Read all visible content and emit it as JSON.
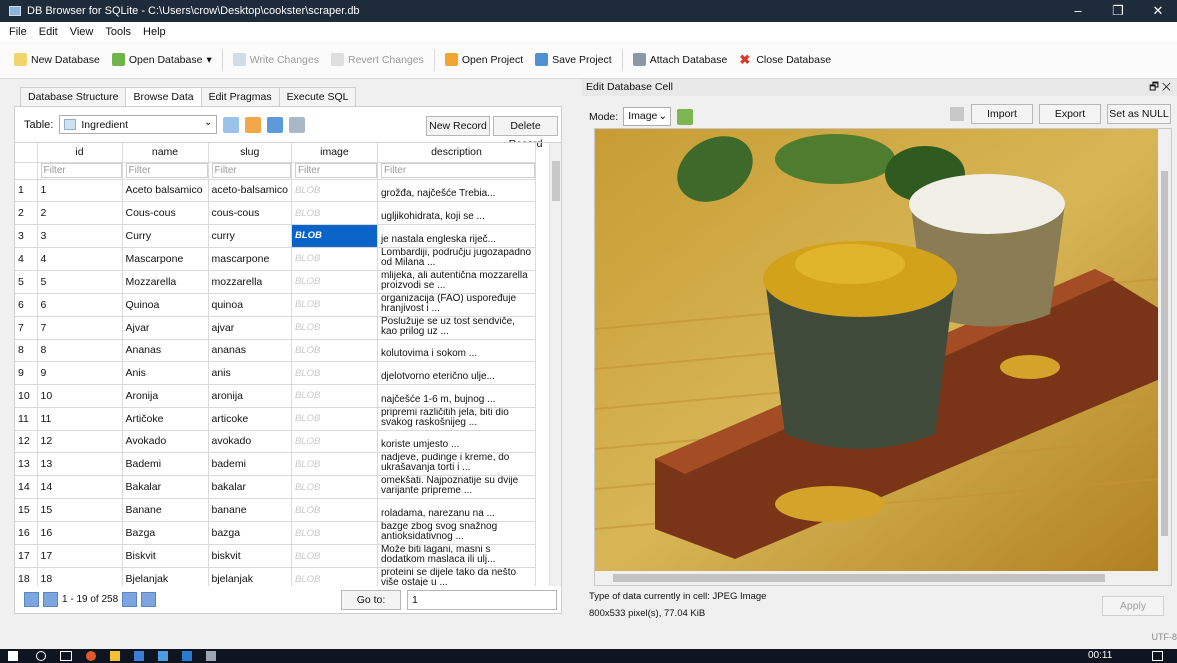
{
  "window": {
    "title": "DB Browser for SQLite - C:\\Users\\crow\\Desktop\\cookster\\scraper.db",
    "min": "–",
    "max": "❐",
    "close": "✕"
  },
  "menu": [
    "File",
    "Edit",
    "View",
    "Tools",
    "Help"
  ],
  "toolbar": {
    "new_db": "New Database",
    "open_db": "Open Database",
    "write": "Write Changes",
    "revert": "Revert Changes",
    "open_project": "Open Project",
    "save_project": "Save Project",
    "attach": "Attach Database",
    "close_db": "Close Database"
  },
  "tabs": [
    "Database Structure",
    "Browse Data",
    "Edit Pragmas",
    "Execute SQL"
  ],
  "browse": {
    "table_label": "Table:",
    "table_value": "Ingredient",
    "new_record": "New Record",
    "delete_record": "Delete Record",
    "columns": [
      "id",
      "name",
      "slug",
      "image",
      "description"
    ],
    "filter": "Filter",
    "rows": [
      [
        "1",
        "1",
        "Aceto balsamico",
        "aceto-balsamico",
        "BLOB",
        "grožđa, najčešće Trebia..."
      ],
      [
        "2",
        "2",
        "Cous-cous",
        "cous-cous",
        "BLOB",
        "ugljikohidrata, koji se ..."
      ],
      [
        "3",
        "3",
        "Curry",
        "curry",
        "BLOB",
        "je nastala engleska riječ..."
      ],
      [
        "4",
        "4",
        "Mascarpone",
        "mascarpone",
        "BLOB",
        "Lombardiji, području jugozapadno od Milana ..."
      ],
      [
        "5",
        "5",
        "Mozzarella",
        "mozzarella",
        "BLOB",
        "mlijeka, ali autentična mozzarella proizvodi se ..."
      ],
      [
        "6",
        "6",
        "Quinoa",
        "quinoa",
        "BLOB",
        "organizacija (FAO) uspoređuje hranjivost i ..."
      ],
      [
        "7",
        "7",
        "Ajvar",
        "ajvar",
        "BLOB",
        "Poslužuje se uz tost sendviče, kao prilog uz ..."
      ],
      [
        "8",
        "8",
        "Ananas",
        "ananas",
        "BLOB",
        "kolutovima i sokom ..."
      ],
      [
        "9",
        "9",
        "Anis",
        "anis",
        "BLOB",
        "djelotvorno eterično ulje..."
      ],
      [
        "10",
        "10",
        "Aronija",
        "aronija",
        "BLOB",
        "najčešće 1-6 m, bujnog ..."
      ],
      [
        "11",
        "11",
        "Artičoke",
        "articoke",
        "BLOB",
        "pripremi različitih jela, biti dio svakog raskošnijeg ..."
      ],
      [
        "12",
        "12",
        "Avokado",
        "avokado",
        "BLOB",
        "koriste umjesto ..."
      ],
      [
        "13",
        "13",
        "Bademi",
        "bademi",
        "BLOB",
        "nadjeve, pudinge i kreme, do ukrašavanja torti i ..."
      ],
      [
        "14",
        "14",
        "Bakalar",
        "bakalar",
        "BLOB",
        "omekšati. Najpoznatije su dvije varijante pripreme ..."
      ],
      [
        "15",
        "15",
        "Banane",
        "banane",
        "BLOB",
        "roladama, narezanu na ..."
      ],
      [
        "16",
        "16",
        "Bazga",
        "bazga",
        "BLOB",
        "bazge zbog svog snažnog antioksidativnog ..."
      ],
      [
        "17",
        "17",
        "Biskvit",
        "biskvit",
        "BLOB",
        "Može biti lagani, masni s dodatkom maslaca ili ulj..."
      ],
      [
        "18",
        "18",
        "Bjelanjak",
        "bjelanjak",
        "BLOB",
        "proteini se dijele tako da nešto više ostaje u ..."
      ]
    ],
    "paging": "1 - 19 of 258",
    "goto_label": "Go to:",
    "goto_value": "1"
  },
  "cell": {
    "title": "Edit Database Cell",
    "mode_label": "Mode:",
    "mode_value": "Image",
    "import": "Import",
    "export": "Export",
    "set_null": "Set as NULL",
    "type_info": "Type of data currently in cell: JPEG Image",
    "size_info": "800x533 pixel(s), 77.04 KiB",
    "apply": "Apply",
    "float": "🗗 ✕"
  },
  "status": {
    "encoding": "UTF-8"
  },
  "taskbar": {
    "clock": "00:11"
  }
}
